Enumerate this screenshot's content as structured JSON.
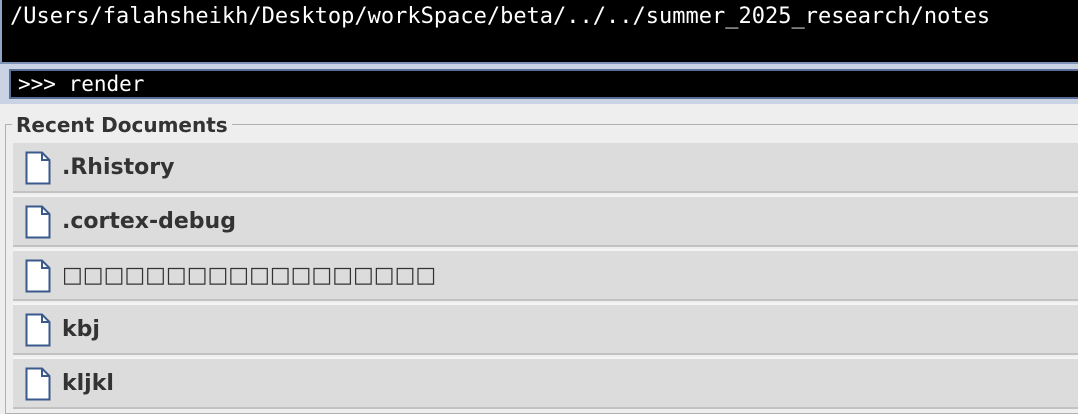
{
  "path_bar": {
    "path": "/Users/falahsheikh/Desktop/workSpace/beta/../../summer_2025_research/notes"
  },
  "command": {
    "value": ">>> render"
  },
  "recent_documents": {
    "title": "Recent Documents",
    "items": [
      {
        "label": ".Rhistory",
        "icon": "document-icon"
      },
      {
        "label": ".cortex-debug",
        "icon": "document-icon"
      },
      {
        "label": "□□□□□□□□□□□□□□□□□□",
        "icon": "document-icon"
      },
      {
        "label": "kbj",
        "icon": "document-icon"
      },
      {
        "label": "kljkl",
        "icon": "document-icon"
      }
    ]
  },
  "colors": {
    "terminal_bg": "#000000",
    "frame_blue": "#c9d3e3",
    "list_bg": "#dcdcdc",
    "icon_stroke": "#3a5a8c"
  }
}
